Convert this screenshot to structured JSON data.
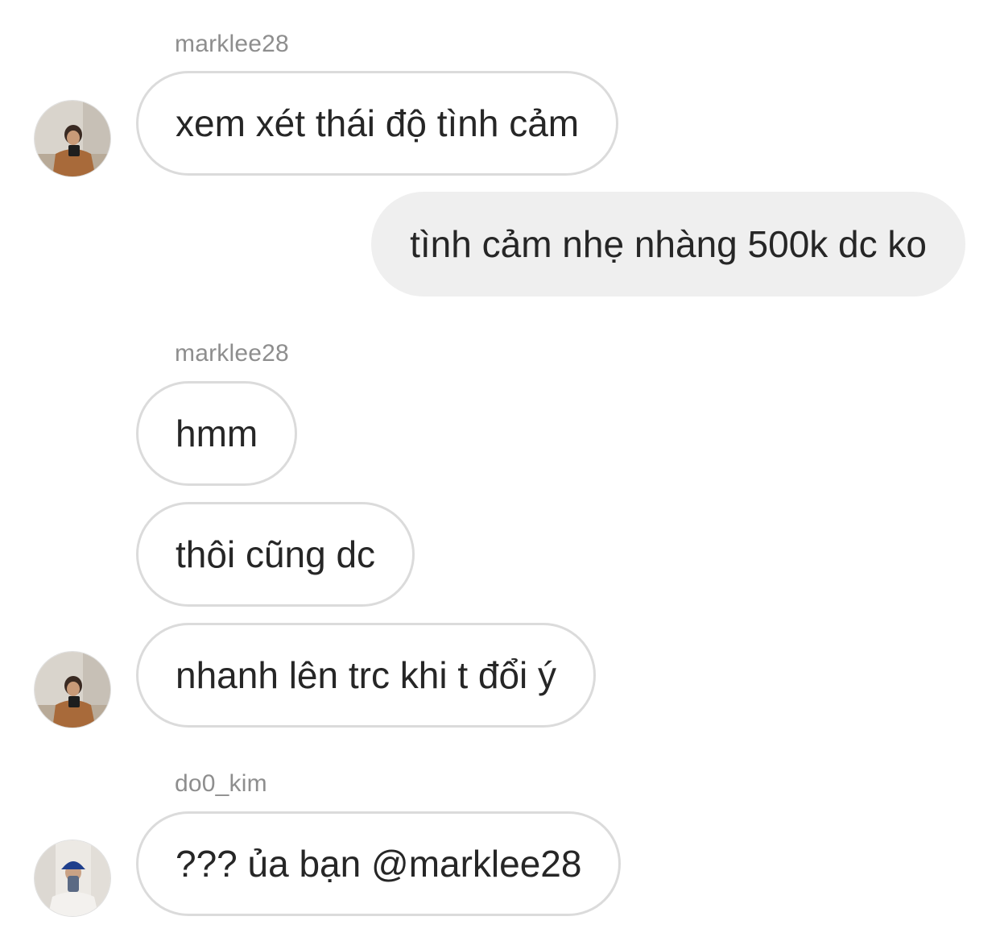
{
  "messages": [
    {
      "sender": "marklee28",
      "text": "xem xét thái độ tình cảm",
      "direction": "incoming",
      "show_name": true,
      "show_avatar": true
    },
    {
      "sender": "me",
      "text": "tình cảm nhẹ nhàng 500k dc ko",
      "direction": "outgoing"
    },
    {
      "sender": "marklee28",
      "text": "hmm",
      "direction": "incoming",
      "show_name": true,
      "show_avatar": false
    },
    {
      "sender": "marklee28",
      "text": "thôi cũng dc",
      "direction": "incoming",
      "show_name": false,
      "show_avatar": false
    },
    {
      "sender": "marklee28",
      "text": "nhanh lên trc khi t đổi ý",
      "direction": "incoming",
      "show_name": false,
      "show_avatar": true
    },
    {
      "sender": "do0_kim",
      "text": "??? ủa bạn @marklee28",
      "direction": "incoming",
      "show_name": true,
      "show_avatar": true
    }
  ],
  "colors": {
    "incoming_border": "#dbdbdb",
    "outgoing_bg": "#efefef",
    "username_text": "#8e8e8e",
    "message_text": "#262626"
  },
  "icons": {
    "avatar_marklee28": "profile-photo",
    "avatar_do0_kim": "profile-photo"
  }
}
